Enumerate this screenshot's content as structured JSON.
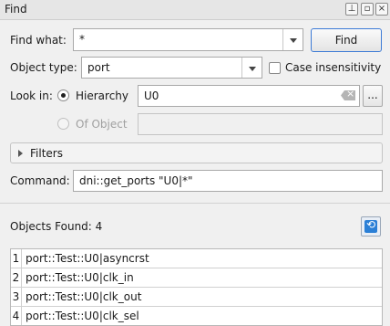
{
  "window": {
    "title": "Find"
  },
  "titlebar_icons": [
    "pin-icon",
    "float-icon",
    "close-icon"
  ],
  "find": {
    "label": "Find what:",
    "value": "*",
    "button_label": "Find"
  },
  "object_type": {
    "label": "Object type:",
    "value": "port",
    "case_label": "Case insensitivity",
    "case_checked": false
  },
  "look_in": {
    "label": "Look in:",
    "hierarchy_label": "Hierarchy",
    "hierarchy_value": "U0",
    "browse_label": "...",
    "of_object_label": "Of Object",
    "of_object_value": ""
  },
  "filters": {
    "label": "Filters"
  },
  "command": {
    "label": "Command:",
    "value": "dni::get_ports \"U0|*\""
  },
  "results": {
    "label": "Objects Found: 4",
    "rows": [
      {
        "index": "1",
        "name": "port::Test::U0|asyncrst"
      },
      {
        "index": "2",
        "name": "port::Test::U0|clk_in"
      },
      {
        "index": "3",
        "name": "port::Test::U0|clk_out"
      },
      {
        "index": "4",
        "name": "port::Test::U0|clk_sel"
      }
    ]
  },
  "colors": {
    "accent": "#3d7bd6",
    "icon_blue": "#2a7fd6"
  }
}
